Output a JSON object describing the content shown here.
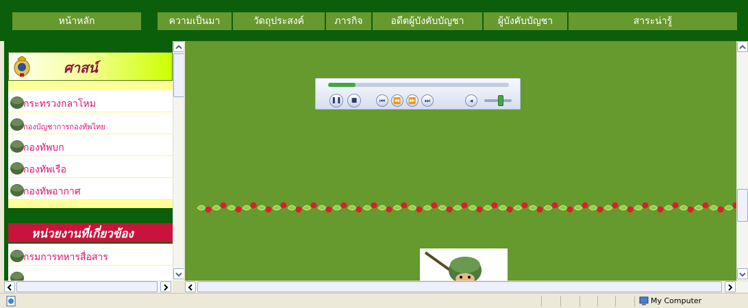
{
  "topnav": {
    "items": [
      {
        "label": "หน้าหลัก"
      },
      {
        "label": "ความเป็นมา"
      },
      {
        "label": "วัดถุประสงค์"
      },
      {
        "label": "ภารกิจ"
      },
      {
        "label": "อดีตผู้บังคับบัญชา"
      },
      {
        "label": "ผู้บังคับบัญชา"
      },
      {
        "label": "สาระน่ารู้"
      }
    ]
  },
  "left": {
    "sasana_header": "ศาสน์",
    "menu": [
      {
        "label": "กระทรวงกลาโหม"
      },
      {
        "label": "กองบัญชาการกองทัพไทย"
      },
      {
        "label": "กองทัพบก"
      },
      {
        "label": "กองทัพเรือ"
      },
      {
        "label": "กองทัพอากาศ"
      }
    ],
    "related_header": "หน่วยงานที่เกี่ยวข้อง",
    "related_menu": [
      {
        "label": "กรมการทหารสื่อสาร"
      },
      {
        "label": ""
      }
    ]
  },
  "player": {
    "progress": 0.15,
    "volume": 0.6,
    "buttons": [
      "play-pause-icon",
      "stop-icon",
      "previous-icon",
      "rewind-icon",
      "fast-forward-icon",
      "next-icon",
      "mute-icon"
    ]
  },
  "status": {
    "zone": "My Computer"
  },
  "colors": {
    "nav_bg": "#0b5f0b",
    "nav_cell": "#66992e",
    "main_bg": "#66992e",
    "menu_text": "#e0116f",
    "related_header_bg": "#c8143c"
  }
}
